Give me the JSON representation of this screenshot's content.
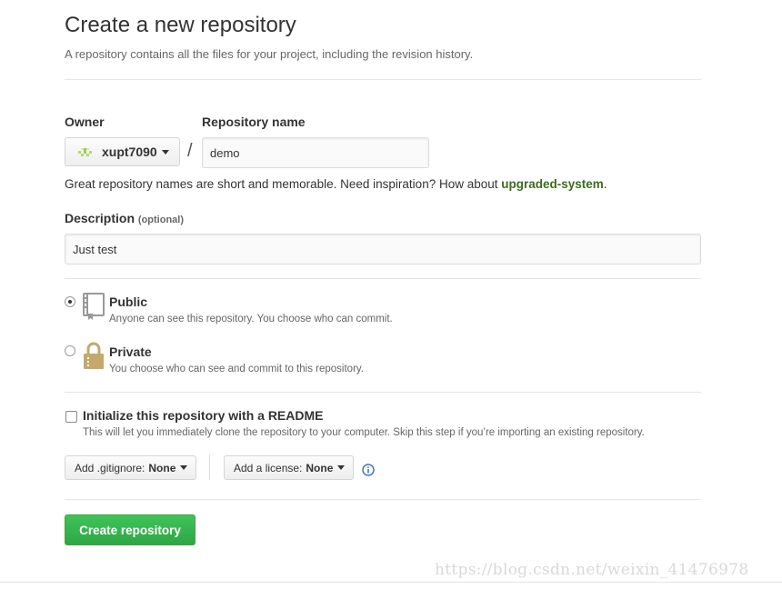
{
  "page": {
    "title": "Create a new repository",
    "subtitle": "A repository contains all the files for your project, including the revision history."
  },
  "owner": {
    "label": "Owner",
    "value": "xupt7090"
  },
  "repo": {
    "label": "Repository name",
    "separator": "/",
    "value": "demo",
    "hint_prefix": "Great repository names are short and memorable. Need inspiration? How about ",
    "suggestion": "upgraded-system",
    "hint_suffix": "."
  },
  "description": {
    "label": "Description",
    "optional": "(optional)",
    "value": "Just test"
  },
  "visibility": {
    "public": {
      "title": "Public",
      "desc": "Anyone can see this repository. You choose who can commit.",
      "selected": true
    },
    "private": {
      "title": "Private",
      "desc": "You choose who can see and commit to this repository.",
      "selected": false
    }
  },
  "readme": {
    "title": "Initialize this repository with a README",
    "desc": "This will let you immediately clone the repository to your computer. Skip this step if you’re importing an existing repository.",
    "checked": false
  },
  "gitignore": {
    "prefix": "Add .gitignore:",
    "value": "None"
  },
  "license": {
    "prefix": "Add a license:",
    "value": "None"
  },
  "submit": {
    "label": "Create repository"
  },
  "watermark": "https://blog.csdn.net/weixin_41476978",
  "colors": {
    "accent_green": "#2ea744",
    "suggestion_green": "#3d6b1f",
    "info_blue": "#4078c0"
  },
  "icons": {
    "owner_avatar": "identicon-icon",
    "public": "repo-book-icon",
    "private": "lock-icon",
    "info": "info-icon",
    "dropdown": "caret-down-icon"
  }
}
